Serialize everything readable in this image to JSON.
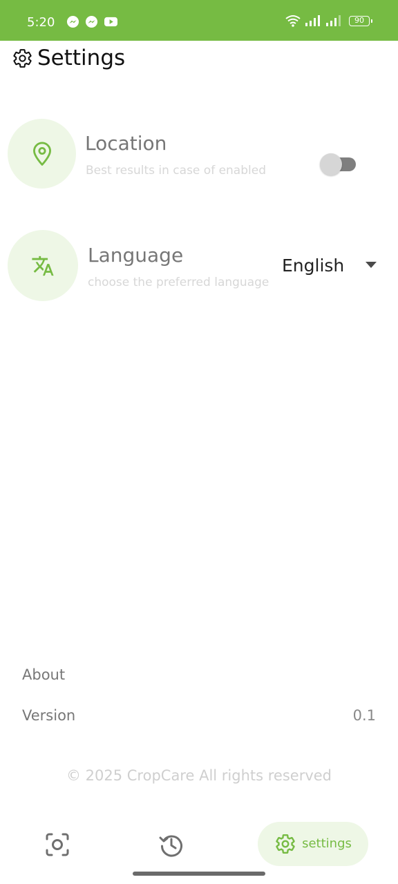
{
  "status_bar": {
    "time": "5:20",
    "app_icons": [
      "messenger-icon",
      "messenger-icon",
      "youtube-icon"
    ],
    "battery_level": "90",
    "background_color": "#76bb43"
  },
  "header": {
    "title": "Settings",
    "icon": "gear-icon"
  },
  "settings": {
    "location": {
      "title": "Location",
      "subtitle": "Best results in case of enabled",
      "enabled": false,
      "icon": "location-pin-icon"
    },
    "language": {
      "title": "Language",
      "subtitle": "choose the preferred language",
      "selected": "English",
      "icon": "translate-icon"
    }
  },
  "footer": {
    "about_label": "About",
    "version_label": "Version",
    "version_value": "0.1",
    "copyright": "© 2025 CropCare All rights reserved"
  },
  "bottom_nav": {
    "items": [
      {
        "icon": "scan-camera-icon",
        "label": "",
        "active": false
      },
      {
        "icon": "history-icon",
        "label": "",
        "active": false
      },
      {
        "icon": "gear-icon",
        "label": "settings",
        "active": true
      }
    ]
  },
  "colors": {
    "accent": "#76bb43",
    "accent_light": "#eef7e6",
    "title_gray": "#767676",
    "subtitle_gray": "#d7d7d7"
  }
}
